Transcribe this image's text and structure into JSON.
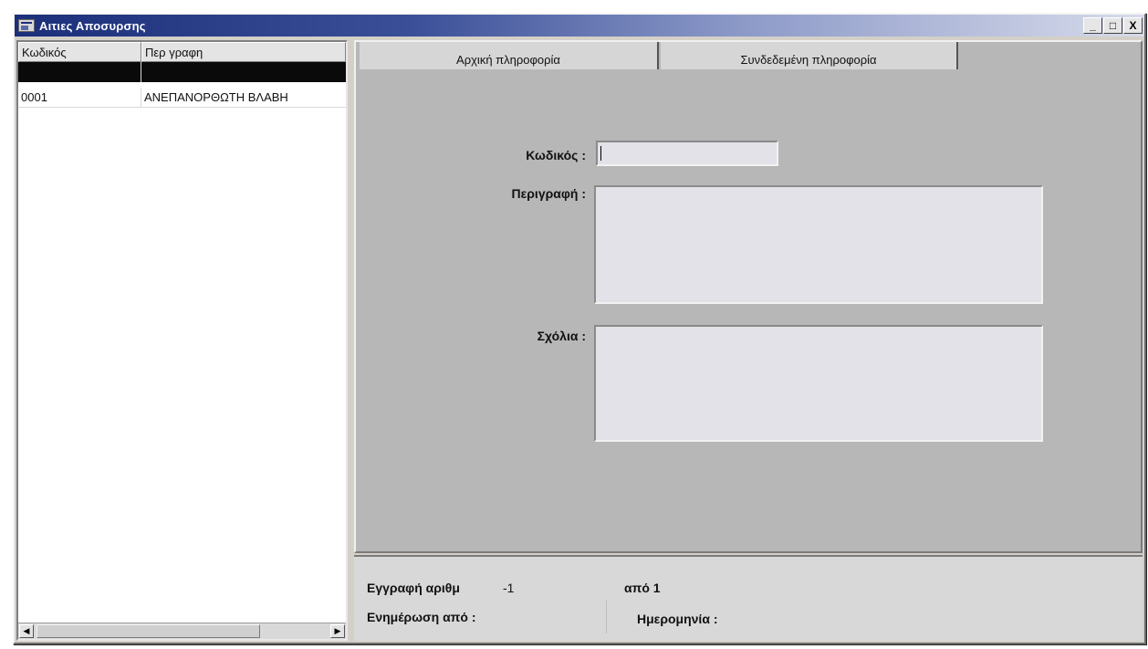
{
  "window": {
    "title": "Αιτιες Αποσυρσης",
    "controls": {
      "minimize": "_",
      "maximize": "□",
      "close": "X"
    }
  },
  "list": {
    "columns": [
      "Κωδικός",
      "Περ γραφη"
    ],
    "rows": [
      {
        "code": "0001",
        "description": "ΑΝΕΠΑΝΟΡΘΩΤΗ ΒΛΑΒΗ"
      }
    ],
    "scroll_left": "◀",
    "scroll_right": "▶"
  },
  "tabs": [
    {
      "label": "Αρχική πληροφορία"
    },
    {
      "label": "Συνδεδεμένη πληροφορία"
    }
  ],
  "form": {
    "code_label": "Κωδικός :",
    "code_value": "",
    "description_label": "Περιγραφή :",
    "description_value": "",
    "notes_label": "Σχόλια :",
    "notes_value": ""
  },
  "status": {
    "record_label": "Εγγραφή αριθμ",
    "record_value": "-1",
    "of_label": "από 1",
    "updated_by_label": "Ενημέρωση από :",
    "date_label": "Ημερομηνία :"
  }
}
